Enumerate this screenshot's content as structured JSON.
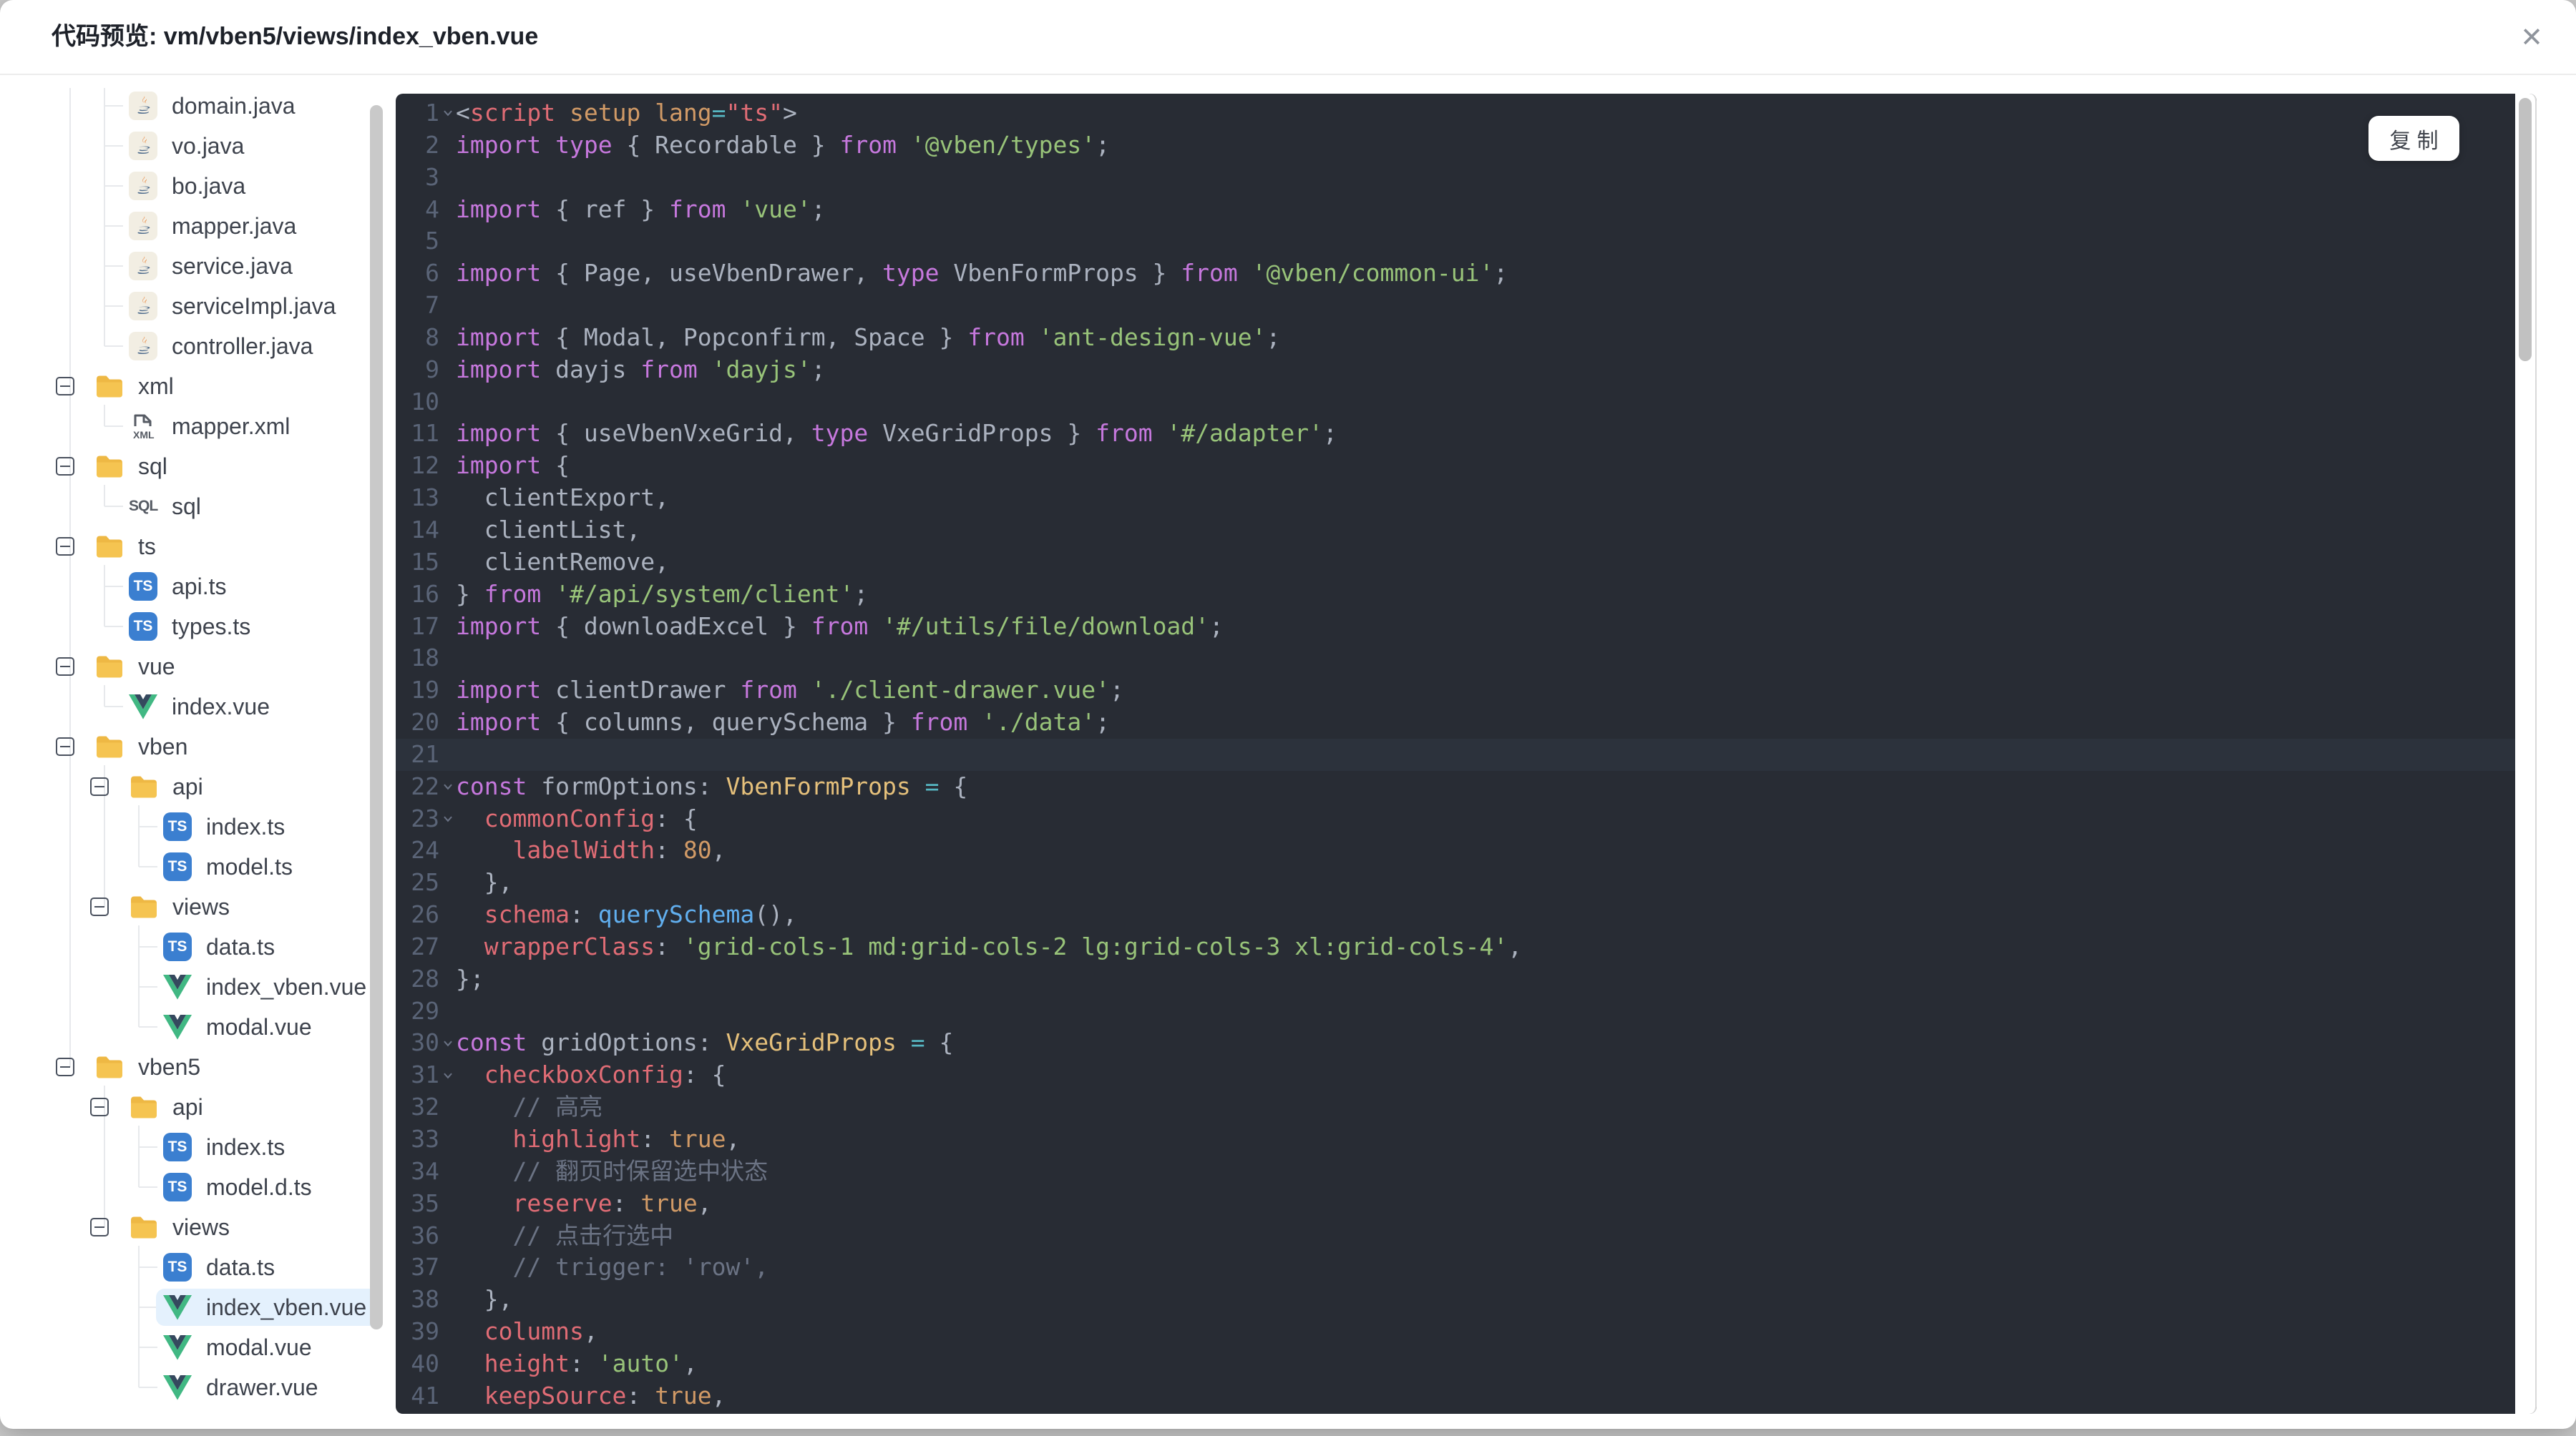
{
  "dialog": {
    "title": "代码预览: vm/vben5/views/index_vben.vue",
    "close_icon": "✕"
  },
  "tree": {
    "items": [
      {
        "label": "domain.java",
        "icon": "java-icon",
        "level": 1
      },
      {
        "label": "vo.java",
        "icon": "java-icon",
        "level": 1
      },
      {
        "label": "bo.java",
        "icon": "java-icon",
        "level": 1
      },
      {
        "label": "mapper.java",
        "icon": "java-icon",
        "level": 1
      },
      {
        "label": "service.java",
        "icon": "java-icon",
        "level": 1
      },
      {
        "label": "serviceImpl.java",
        "icon": "java-icon",
        "level": 1
      },
      {
        "label": "controller.java",
        "icon": "java-icon",
        "level": 1
      },
      {
        "label": "xml",
        "icon": "folder-icon",
        "level": 0,
        "folder": true,
        "expanded": true
      },
      {
        "label": "mapper.xml",
        "icon": "xml-icon",
        "level": 1
      },
      {
        "label": "sql",
        "icon": "folder-icon",
        "level": 0,
        "folder": true,
        "expanded": true
      },
      {
        "label": "sql",
        "icon": "sql-icon",
        "level": 1
      },
      {
        "label": "ts",
        "icon": "folder-icon",
        "level": 0,
        "folder": true,
        "expanded": true
      },
      {
        "label": "api.ts",
        "icon": "ts-icon",
        "level": 1
      },
      {
        "label": "types.ts",
        "icon": "ts-icon",
        "level": 1
      },
      {
        "label": "vue",
        "icon": "folder-icon",
        "level": 0,
        "folder": true,
        "expanded": true
      },
      {
        "label": "index.vue",
        "icon": "vue-icon",
        "level": 1
      },
      {
        "label": "vben",
        "icon": "folder-icon",
        "level": 0,
        "folder": true,
        "expanded": true
      },
      {
        "label": "api",
        "icon": "folder-icon",
        "level": 1,
        "folder": true,
        "expanded": true
      },
      {
        "label": "index.ts",
        "icon": "ts-icon",
        "level": 2
      },
      {
        "label": "model.ts",
        "icon": "ts-icon",
        "level": 2
      },
      {
        "label": "views",
        "icon": "folder-icon",
        "level": 1,
        "folder": true,
        "expanded": true
      },
      {
        "label": "data.ts",
        "icon": "ts-icon",
        "level": 2
      },
      {
        "label": "index_vben.vue",
        "icon": "vue-icon",
        "level": 2
      },
      {
        "label": "modal.vue",
        "icon": "vue-icon",
        "level": 2
      },
      {
        "label": "vben5",
        "icon": "folder-icon",
        "level": 0,
        "folder": true,
        "expanded": true
      },
      {
        "label": "api",
        "icon": "folder-icon",
        "level": 1,
        "folder": true,
        "expanded": true
      },
      {
        "label": "index.ts",
        "icon": "ts-icon",
        "level": 2
      },
      {
        "label": "model.d.ts",
        "icon": "ts-icon",
        "level": 2
      },
      {
        "label": "views",
        "icon": "folder-icon",
        "level": 1,
        "folder": true,
        "expanded": true
      },
      {
        "label": "data.ts",
        "icon": "ts-icon",
        "level": 2
      },
      {
        "label": "index_vben.vue",
        "icon": "vue-icon",
        "level": 2,
        "selected": true
      },
      {
        "label": "modal.vue",
        "icon": "vue-icon",
        "level": 2
      },
      {
        "label": "drawer.vue",
        "icon": "vue-icon",
        "level": 2
      }
    ]
  },
  "code": {
    "copy_label": "复 制",
    "lines": [
      {
        "n": 1,
        "f": true,
        "t": [
          [
            "d",
            "<"
          ],
          [
            "r",
            "script"
          ],
          [
            "d",
            " "
          ],
          [
            "n",
            "setup"
          ],
          [
            "d",
            " "
          ],
          [
            "n",
            "lang"
          ],
          [
            "o",
            "="
          ],
          [
            "r",
            "\"ts\""
          ],
          [
            "d",
            ">"
          ]
        ]
      },
      {
        "n": 2,
        "t": [
          [
            "k",
            "import"
          ],
          [
            "d",
            " "
          ],
          [
            "k",
            "type"
          ],
          [
            "d",
            " { Recordable } "
          ],
          [
            "k",
            "from"
          ],
          [
            "d",
            " "
          ],
          [
            "s",
            "'@vben/types'"
          ],
          [
            "d",
            ";"
          ]
        ]
      },
      {
        "n": 3,
        "t": []
      },
      {
        "n": 4,
        "t": [
          [
            "k",
            "import"
          ],
          [
            "d",
            " { ref } "
          ],
          [
            "k",
            "from"
          ],
          [
            "d",
            " "
          ],
          [
            "s",
            "'vue'"
          ],
          [
            "d",
            ";"
          ]
        ]
      },
      {
        "n": 5,
        "t": []
      },
      {
        "n": 6,
        "t": [
          [
            "k",
            "import"
          ],
          [
            "d",
            " { Page, useVbenDrawer, "
          ],
          [
            "k",
            "type"
          ],
          [
            "d",
            " VbenFormProps } "
          ],
          [
            "k",
            "from"
          ],
          [
            "d",
            " "
          ],
          [
            "s",
            "'@vben/common-ui'"
          ],
          [
            "d",
            ";"
          ]
        ]
      },
      {
        "n": 7,
        "t": []
      },
      {
        "n": 8,
        "t": [
          [
            "k",
            "import"
          ],
          [
            "d",
            " { Modal, Popconfirm, Space } "
          ],
          [
            "k",
            "from"
          ],
          [
            "d",
            " "
          ],
          [
            "s",
            "'ant-design-vue'"
          ],
          [
            "d",
            ";"
          ]
        ]
      },
      {
        "n": 9,
        "t": [
          [
            "k",
            "import"
          ],
          [
            "d",
            " dayjs "
          ],
          [
            "k",
            "from"
          ],
          [
            "d",
            " "
          ],
          [
            "s",
            "'dayjs'"
          ],
          [
            "d",
            ";"
          ]
        ]
      },
      {
        "n": 10,
        "t": []
      },
      {
        "n": 11,
        "t": [
          [
            "k",
            "import"
          ],
          [
            "d",
            " { useVbenVxeGrid, "
          ],
          [
            "k",
            "type"
          ],
          [
            "d",
            " VxeGridProps } "
          ],
          [
            "k",
            "from"
          ],
          [
            "d",
            " "
          ],
          [
            "s",
            "'#/adapter'"
          ],
          [
            "d",
            ";"
          ]
        ]
      },
      {
        "n": 12,
        "t": [
          [
            "k",
            "import"
          ],
          [
            "d",
            " {"
          ]
        ]
      },
      {
        "n": 13,
        "t": [
          [
            "d",
            "  clientExport,"
          ]
        ]
      },
      {
        "n": 14,
        "t": [
          [
            "d",
            "  clientList,"
          ]
        ]
      },
      {
        "n": 15,
        "t": [
          [
            "d",
            "  clientRemove,"
          ]
        ]
      },
      {
        "n": 16,
        "t": [
          [
            "d",
            "} "
          ],
          [
            "k",
            "from"
          ],
          [
            "d",
            " "
          ],
          [
            "s",
            "'#/api/system/client'"
          ],
          [
            "d",
            ";"
          ]
        ]
      },
      {
        "n": 17,
        "t": [
          [
            "k",
            "import"
          ],
          [
            "d",
            " { downloadExcel } "
          ],
          [
            "k",
            "from"
          ],
          [
            "d",
            " "
          ],
          [
            "s",
            "'#/utils/file/download'"
          ],
          [
            "d",
            ";"
          ]
        ]
      },
      {
        "n": 18,
        "t": []
      },
      {
        "n": 19,
        "t": [
          [
            "k",
            "import"
          ],
          [
            "d",
            " clientDrawer "
          ],
          [
            "k",
            "from"
          ],
          [
            "d",
            " "
          ],
          [
            "s",
            "'./client-drawer.vue'"
          ],
          [
            "d",
            ";"
          ]
        ]
      },
      {
        "n": 20,
        "t": [
          [
            "k",
            "import"
          ],
          [
            "d",
            " { columns, querySchema } "
          ],
          [
            "k",
            "from"
          ],
          [
            "d",
            " "
          ],
          [
            "s",
            "'./data'"
          ],
          [
            "d",
            ";"
          ]
        ]
      },
      {
        "n": 21,
        "a": true,
        "t": []
      },
      {
        "n": 22,
        "f": true,
        "t": [
          [
            "k",
            "const"
          ],
          [
            "d",
            " formOptions: "
          ],
          [
            "t",
            "VbenFormProps"
          ],
          [
            "d",
            " "
          ],
          [
            "o",
            "="
          ],
          [
            "d",
            " {"
          ]
        ]
      },
      {
        "n": 23,
        "f": true,
        "t": [
          [
            "d",
            "  "
          ],
          [
            "r",
            "commonConfig"
          ],
          [
            "d",
            ": {"
          ]
        ]
      },
      {
        "n": 24,
        "t": [
          [
            "d",
            "    "
          ],
          [
            "r",
            "labelWidth"
          ],
          [
            "d",
            ": "
          ],
          [
            "n",
            "80"
          ],
          [
            "d",
            ","
          ]
        ]
      },
      {
        "n": 25,
        "t": [
          [
            "d",
            "  },"
          ]
        ]
      },
      {
        "n": 26,
        "t": [
          [
            "d",
            "  "
          ],
          [
            "r",
            "schema"
          ],
          [
            "d",
            ": "
          ],
          [
            "f",
            "querySchema"
          ],
          [
            "d",
            "(),"
          ]
        ]
      },
      {
        "n": 27,
        "t": [
          [
            "d",
            "  "
          ],
          [
            "r",
            "wrapperClass"
          ],
          [
            "d",
            ": "
          ],
          [
            "s",
            "'grid-cols-1 md:grid-cols-2 lg:grid-cols-3 xl:grid-cols-4'"
          ],
          [
            "d",
            ","
          ]
        ]
      },
      {
        "n": 28,
        "t": [
          [
            "d",
            "};"
          ]
        ]
      },
      {
        "n": 29,
        "t": []
      },
      {
        "n": 30,
        "f": true,
        "t": [
          [
            "k",
            "const"
          ],
          [
            "d",
            " gridOptions: "
          ],
          [
            "t",
            "VxeGridProps"
          ],
          [
            "d",
            " "
          ],
          [
            "o",
            "="
          ],
          [
            "d",
            " {"
          ]
        ]
      },
      {
        "n": 31,
        "f": true,
        "t": [
          [
            "d",
            "  "
          ],
          [
            "r",
            "checkboxConfig"
          ],
          [
            "d",
            ": {"
          ]
        ]
      },
      {
        "n": 32,
        "t": [
          [
            "c",
            "    // 高亮"
          ]
        ]
      },
      {
        "n": 33,
        "t": [
          [
            "d",
            "    "
          ],
          [
            "r",
            "highlight"
          ],
          [
            "d",
            ": "
          ],
          [
            "n",
            "true"
          ],
          [
            "d",
            ","
          ]
        ]
      },
      {
        "n": 34,
        "t": [
          [
            "c",
            "    // 翻页时保留选中状态"
          ]
        ]
      },
      {
        "n": 35,
        "t": [
          [
            "d",
            "    "
          ],
          [
            "r",
            "reserve"
          ],
          [
            "d",
            ": "
          ],
          [
            "n",
            "true"
          ],
          [
            "d",
            ","
          ]
        ]
      },
      {
        "n": 36,
        "t": [
          [
            "c",
            "    // 点击行选中"
          ]
        ]
      },
      {
        "n": 37,
        "t": [
          [
            "c",
            "    // trigger: 'row',"
          ]
        ]
      },
      {
        "n": 38,
        "t": [
          [
            "d",
            "  },"
          ]
        ]
      },
      {
        "n": 39,
        "t": [
          [
            "d",
            "  "
          ],
          [
            "r",
            "columns"
          ],
          [
            "d",
            ","
          ]
        ]
      },
      {
        "n": 40,
        "t": [
          [
            "d",
            "  "
          ],
          [
            "r",
            "height"
          ],
          [
            "d",
            ": "
          ],
          [
            "s",
            "'auto'"
          ],
          [
            "d",
            ","
          ]
        ]
      },
      {
        "n": 41,
        "t": [
          [
            "d",
            "  "
          ],
          [
            "r",
            "keepSource"
          ],
          [
            "d",
            ": "
          ],
          [
            "n",
            "true"
          ],
          [
            "d",
            ","
          ]
        ]
      }
    ]
  },
  "colors": {
    "editor-bg": "#282c34",
    "editor-active-line": "#2c323c",
    "line-number": "#5a6477",
    "code-default": "#abb2bf",
    "keyword": "#c678dd",
    "string": "#98c379",
    "number": "#d19a66",
    "property": "#e06c75",
    "type": "#e5c07b",
    "function": "#61afef",
    "operator": "#56b6c2",
    "comment": "#6b7384",
    "selected-bg": "#e4f1fd",
    "ts-badge": "#3b7fd0",
    "vue-green": "#41b883",
    "vue-dark": "#35495e",
    "folder-amber": "#f5c451"
  }
}
